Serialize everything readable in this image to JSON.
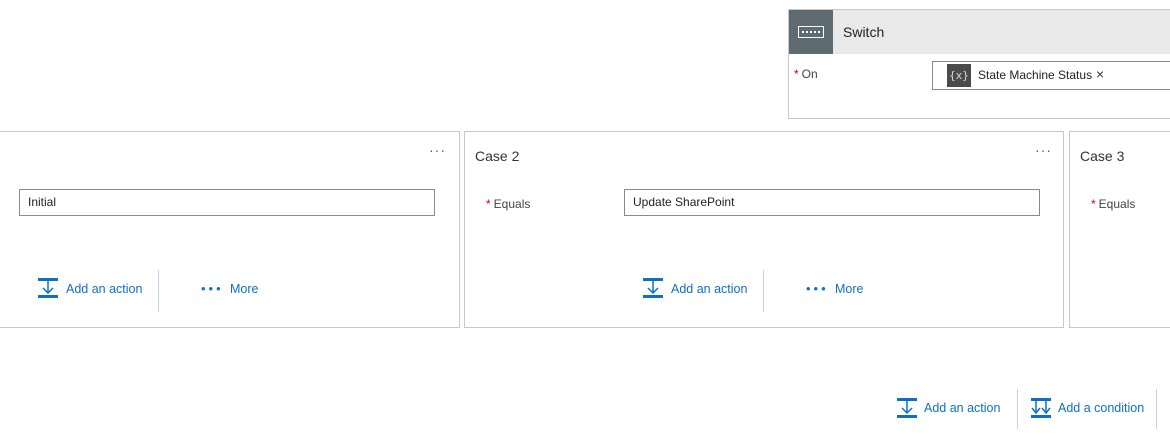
{
  "switch": {
    "title": "Switch",
    "on_label": "On",
    "required_mark": "*",
    "token_icon": "{x}",
    "token_value": "State Machine Status",
    "token_remove": "×"
  },
  "cases": [
    {
      "title": "",
      "menu": "···",
      "equals_label": "",
      "equals_value": "Initial",
      "add_action": "Add an action",
      "more_dots": "•••",
      "more": "More"
    },
    {
      "title": "Case 2",
      "menu": "···",
      "equals_label": "Equals",
      "equals_value": "Update SharePoint",
      "add_action": "Add an action",
      "more_dots": "•••",
      "more": "More"
    },
    {
      "title": "Case 3",
      "equals_label": "Equals"
    }
  ],
  "footer": {
    "add_action": "Add an action",
    "add_condition": "Add a condition"
  },
  "icons": {
    "switch": "switch-icon",
    "add_action": "add-action-icon",
    "add_condition": "add-condition-icon",
    "variable": "variable-icon"
  },
  "colors": {
    "accent": "#0f6fc6",
    "switch_icon_bg": "#5f6b73",
    "required": "#dd0000"
  }
}
